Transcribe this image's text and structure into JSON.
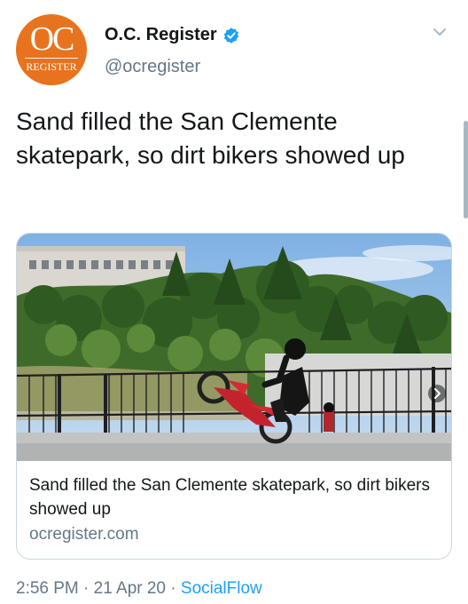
{
  "account": {
    "avatar_text": "OC",
    "avatar_subtext": "REGISTER",
    "display_name": "O.C. Register",
    "handle": "@ocregister"
  },
  "tweet": {
    "text": "Sand filled the San Clemente skatepark, so dirt bikers showed up"
  },
  "card": {
    "title": "Sand filled the San Clemente skatepark, so dirt bikers showed up",
    "domain": "ocregister.com"
  },
  "meta": {
    "time": "2:56 PM",
    "date": "21 Apr 20",
    "source": "SocialFlow",
    "separator": "·"
  },
  "colors": {
    "avatar": "#e8731e",
    "link": "#1da1f2",
    "secondary_text": "#657786"
  },
  "icons": {
    "verified": "verified-badge-icon",
    "menu": "chevron-down-icon",
    "card_nav": "chevron-right-icon"
  }
}
